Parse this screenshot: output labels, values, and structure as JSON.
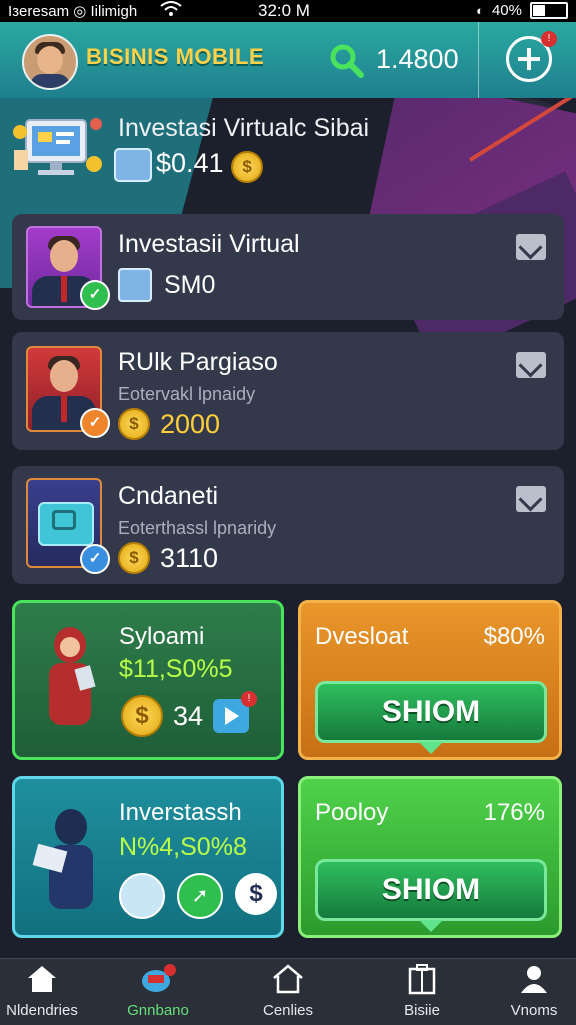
{
  "status_bar": {
    "left_text": "Iзeresam ◎ Iilimigh",
    "time": "32:0 M",
    "battery": "40%"
  },
  "header": {
    "brand": "BISINIS MOBILE",
    "balance": "1.4800"
  },
  "featured": {
    "title": "Investasi Virtualc Sibai",
    "amount": "$0.41"
  },
  "cards": [
    {
      "title": "Investasii Virtual",
      "subtitle": "",
      "amount": "SM0",
      "badge_color": "#2fbf4e"
    },
    {
      "title": "RUlk Pargiaso",
      "subtitle": "Eotervakl lpnaidy",
      "amount": "2000",
      "badge_color": "#f0842a"
    },
    {
      "title": "Cndaneti",
      "subtitle": "Eoterthassl lpnaridy",
      "amount": "3110",
      "badge_color": "#3b8fe0"
    }
  ],
  "tiles": [
    {
      "title": "Syloami",
      "value": "$11,S0%5",
      "count": "34"
    },
    {
      "title": "Dvesloat",
      "percent": "$80%",
      "button": "SHIOM"
    },
    {
      "title": "Inverstassh",
      "value": "N%4,S0%8"
    },
    {
      "title": "Pooloy",
      "percent": "176%",
      "button": "SHIOM"
    }
  ],
  "nav": [
    {
      "label": "Nldendries",
      "icon": "home-icon"
    },
    {
      "label": "Gnnbano",
      "icon": "cart-icon",
      "active": true
    },
    {
      "label": "Cenlies",
      "icon": "house-outline-icon"
    },
    {
      "label": "Bisiie",
      "icon": "building-icon"
    },
    {
      "label": "Vnoms",
      "icon": "profile-icon"
    }
  ],
  "colors": {
    "header": "#2aa9a0",
    "brand": "#ffd24a",
    "accent_green": "#2fbf5e",
    "accent_orange": "#e88a1c",
    "card_bg": "#33394a"
  }
}
